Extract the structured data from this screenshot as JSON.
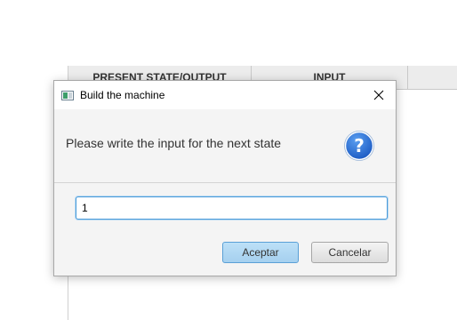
{
  "table": {
    "headers": [
      "PRESENT STATE/OUTPUT",
      "INPUT",
      ""
    ]
  },
  "dialog": {
    "title": "Build the machine",
    "close_icon": "close-icon",
    "message": "Please write the input for the next state",
    "question_icon": "question-icon",
    "input_value": "1",
    "ok_label": "Aceptar",
    "cancel_label": "Cancelar"
  },
  "colors": {
    "accent": "#2f6fd0",
    "focus_border": "#4a9ad8",
    "ok_button_bg": "#bde0f7"
  }
}
